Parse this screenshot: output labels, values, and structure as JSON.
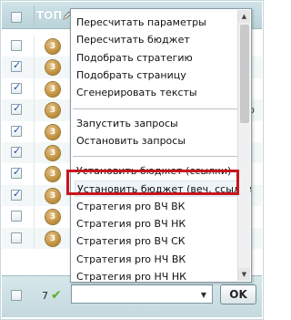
{
  "header": {
    "column_label": "ТОП",
    "pencil_icon": "pencil-icon"
  },
  "rows": [
    {
      "checked": false,
      "badge": "3"
    },
    {
      "checked": true,
      "badge": "3"
    },
    {
      "checked": true,
      "badge": "3"
    },
    {
      "checked": true,
      "badge": "3"
    },
    {
      "checked": true,
      "badge": "3"
    },
    {
      "checked": true,
      "badge": "3"
    },
    {
      "checked": true,
      "badge": "3"
    },
    {
      "checked": true,
      "badge": "3"
    },
    {
      "checked": false,
      "badge": "3"
    },
    {
      "checked": false,
      "badge": "3"
    }
  ],
  "right_fragment": "р",
  "footer": {
    "count": "7",
    "ok_label": "OK",
    "select_value": ""
  },
  "menu": {
    "group1": [
      "Пересчитать параметры",
      "Пересчитать бюджет",
      "Подобрать стратегию",
      "Подобрать страницу",
      "Сгенерировать тексты"
    ],
    "group2": [
      "Запустить запросы",
      "Остановить запросы"
    ],
    "group3": [
      "Установить бюджет (ссылки)",
      "Установить бюджет (веч. ссылки)",
      "Стратегия pro ВЧ ВК",
      "Стратегия pro ВЧ НК",
      "Стратегия pro ВЧ СК",
      "Стратегия pro НЧ ВК",
      "Стратегия pro НЧ НК"
    ],
    "highlighted": "Установить бюджет (веч. ссылки)"
  },
  "colors": {
    "highlight_border": "#c8151d",
    "header_bg": "#c4d9de",
    "check_icon": "#55b02a"
  }
}
